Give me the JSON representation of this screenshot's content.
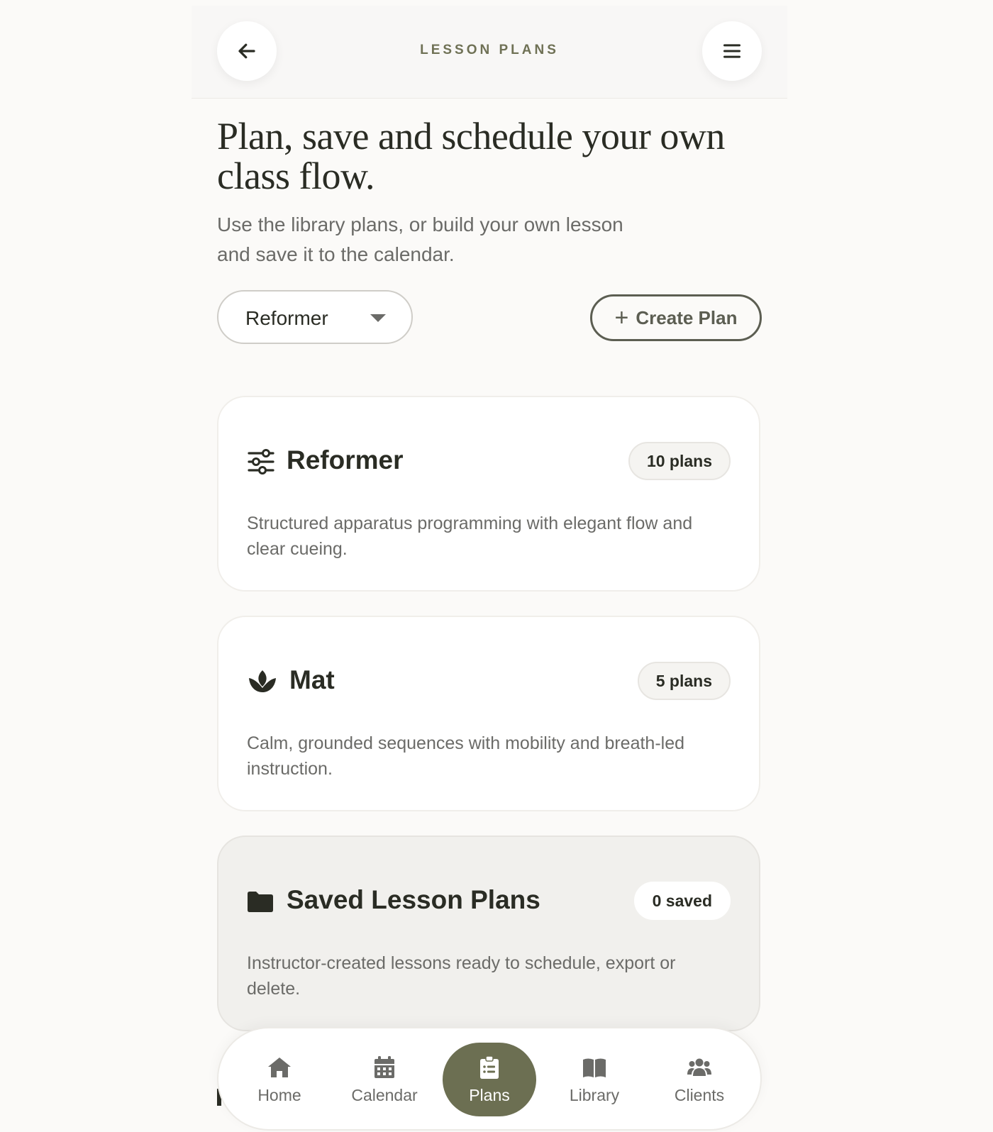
{
  "header": {
    "title": "LESSON PLANS",
    "back_icon": "arrow-left-icon",
    "menu_icon": "hamburger-menu-icon"
  },
  "hero": {
    "title": "Plan, save and schedule your own class flow.",
    "subtitle": "Use the library plans, or build your own lesson and save it to the calendar."
  },
  "controls": {
    "select_value": "Reformer",
    "create_label": "Create Plan",
    "create_icon": "plus-icon"
  },
  "cards": [
    {
      "icon": "sliders-icon",
      "title": "Reformer",
      "badge": "10 plans",
      "description": "Structured apparatus programming with elegant flow and clear cueing."
    },
    {
      "icon": "lotus-icon",
      "title": "Mat",
      "badge": "5 plans",
      "description": "Calm, grounded sequences with mobility and breath-led instruction."
    },
    {
      "icon": "folder-icon",
      "title": "Saved Lesson Plans",
      "badge": "0 saved",
      "description": "Instructor-created lessons ready to schedule, export or delete."
    }
  ],
  "nav": {
    "items": [
      {
        "label": "Home",
        "icon": "home-icon"
      },
      {
        "label": "Calendar",
        "icon": "calendar-icon"
      },
      {
        "label": "Plans",
        "icon": "clipboard-icon"
      },
      {
        "label": "Library",
        "icon": "book-icon"
      },
      {
        "label": "Clients",
        "icon": "users-icon"
      }
    ],
    "active": "Plans"
  },
  "colors": {
    "accent": "#6c6f52",
    "background": "#fbfaf8",
    "text": "#2a2c24",
    "muted": "#6b6b68"
  }
}
